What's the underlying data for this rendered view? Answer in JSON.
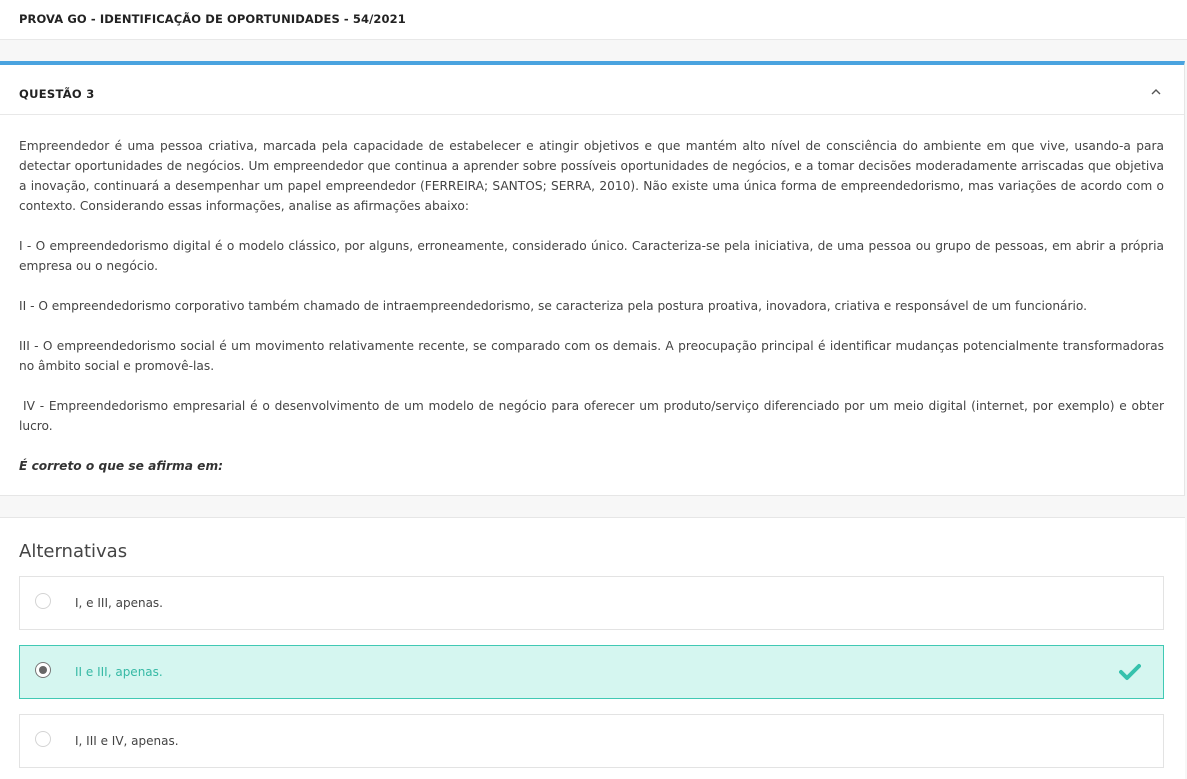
{
  "topbar": {
    "title": "PROVA GO - IDENTIFICAÇÃO DE OPORTUNIDADES - 54/2021"
  },
  "question": {
    "title": "QUESTÃO 3",
    "intro": "Empreendedor é uma pessoa criativa, marcada pela capacidade de estabelecer e atingir objetivos e que mantém alto nível de consciência do ambiente em que vive, usando-a para detectar oportunidades de negócios. Um empreendedor que continua a aprender sobre possíveis oportunidades de negócios, e a tomar decisões moderadamente arriscadas que objetiva a inovação, continuará a desempenhar um papel empreendedor (FERREIRA; SANTOS; SERRA, 2010). Não existe uma única forma de empreendedorismo, mas variações de acordo com o contexto. Considerando essas informações, analise as afirmações abaixo:",
    "statements": [
      "I - O empreendedorismo digital é o modelo clássico, por alguns, erroneamente, considerado único. Caracteriza-se pela iniciativa, de uma pessoa ou grupo de pessoas, em abrir a própria empresa ou o negócio.",
      "II - O empreendedorismo corporativo também chamado de intraempreendedorismo, se caracteriza pela postura proativa, inovadora, criativa e responsável de um funcionário.",
      "III - O empreendedorismo social é um movimento relativamente recente, se comparado com os demais. A preocupação principal é identificar mudanças potencialmente transformadoras no âmbito social e promovê-las.",
      "IV - Empreendedorismo empresarial é o desenvolvimento de um modelo de negócio para oferecer um produto/serviço diferenciado por um meio digital (internet, por exemplo) e obter lucro."
    ],
    "ask": "É correto o que se afirma em:"
  },
  "alternatives": {
    "heading": "Alternativas",
    "items": [
      {
        "label": "I, e III, apenas.",
        "selected": false
      },
      {
        "label": "II e III, apenas.",
        "selected": true
      },
      {
        "label": "I, III e IV, apenas.",
        "selected": false
      }
    ]
  },
  "colors": {
    "accent_blue": "#4aa3df",
    "selected_bg": "#d5f6f0",
    "selected_border": "#40c9b4",
    "selected_text": "#36b9a5"
  },
  "icons": {
    "collapse": "chevron-up-icon",
    "correct": "checkmark-icon"
  }
}
